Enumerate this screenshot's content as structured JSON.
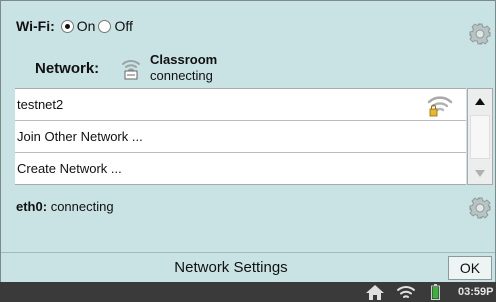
{
  "wifi": {
    "label": "Wi-Fi:",
    "on_label": "On",
    "off_label": "Off",
    "selected": "On"
  },
  "network": {
    "label": "Network:",
    "name": "Classroom",
    "status": "connecting",
    "icon": "wifi-signal-icon"
  },
  "networks_list": [
    {
      "label": "testnet2",
      "icon": "wifi-locked-icon"
    },
    {
      "label": "Join Other Network ..."
    },
    {
      "label": "Create Network ..."
    }
  ],
  "eth": {
    "label": "eth0:",
    "status": "connecting"
  },
  "footer": {
    "title": "Network Settings",
    "ok_label": "OK"
  },
  "taskbar": {
    "clock": "03:59P",
    "icons": [
      "home-icon",
      "wifi-icon",
      "battery-icon"
    ]
  },
  "colors": {
    "dialog_bg": "#c9e3e5",
    "taskbar_bg": "#3a3a3a",
    "battery_green": "#3fae3f"
  }
}
